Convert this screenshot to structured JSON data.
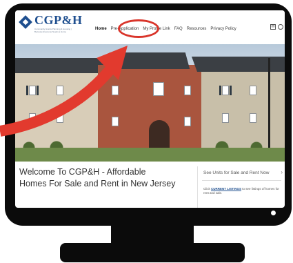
{
  "header": {
    "logo": {
      "name": "CGP&H",
      "tagline": "Community Grants Planning & Housing | Because Everyone Needs a Home"
    },
    "nav": [
      {
        "label": "Home",
        "active": true
      },
      {
        "label": "Pre-Application",
        "active": false
      },
      {
        "label": "My Profile Link",
        "active": false
      },
      {
        "label": "FAQ",
        "active": false
      },
      {
        "label": "Resources",
        "active": false
      },
      {
        "label": "Privacy Policy",
        "active": false
      }
    ],
    "tools": {
      "mail_icon": "mail-icon",
      "search_icon": "search-icon"
    }
  },
  "hero": {
    "image": "apartment-buildings-photo"
  },
  "welcome": {
    "line1": "Welcome To CGP&H - Affordable",
    "line2": "Homes For Sale and Rent in New Jersey"
  },
  "sidebar": {
    "title": "See Units for Sale and Rent Now",
    "text_before": "Click",
    "link": "CURRENT LISTINGS",
    "text_after": "to see listings of homes for rent and sale."
  },
  "annotation": {
    "highlight_color": "#d9352b",
    "arrow_color": "#e23a2e"
  },
  "colors": {
    "brand": "#1f4f8f",
    "monitor": "#0b0b0b"
  }
}
